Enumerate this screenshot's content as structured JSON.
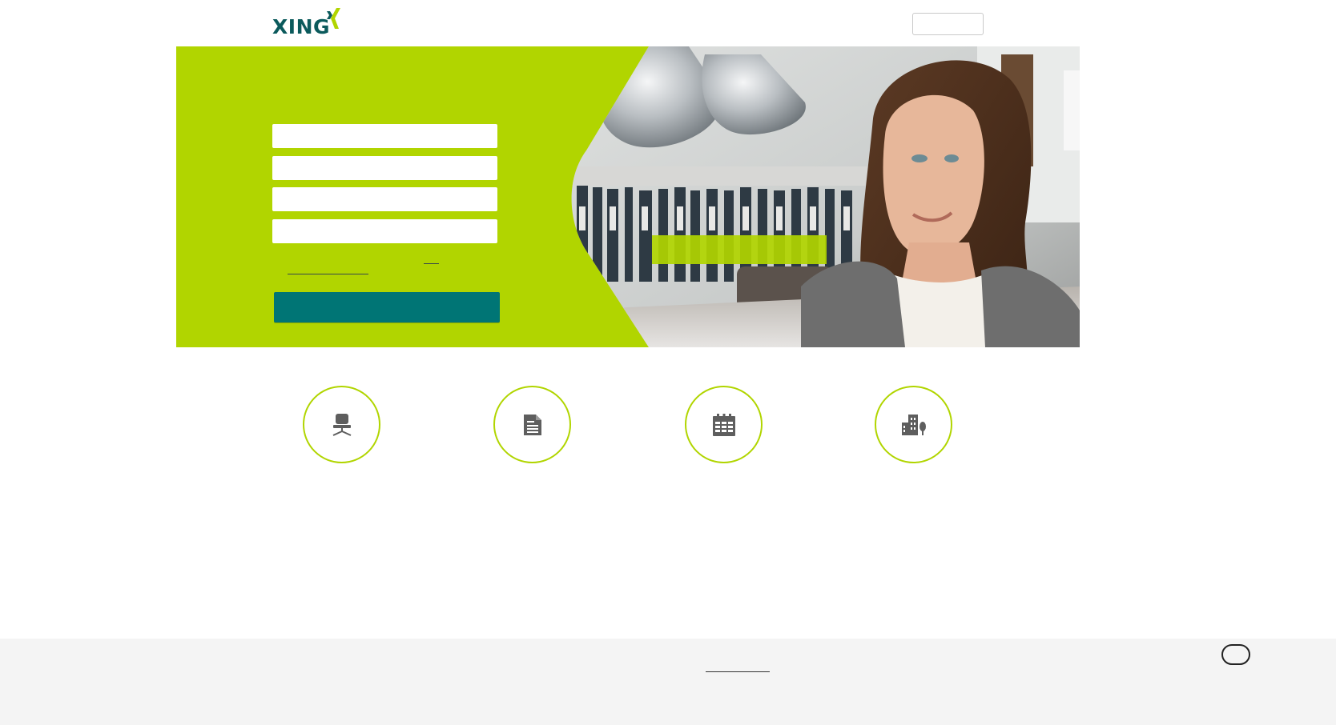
{
  "header": {
    "logo_text": "XING",
    "logo_colors": {
      "text": "#0b5a5c",
      "mark_left": "#0b5a5c",
      "mark_right": "#b1d500"
    }
  },
  "hero": {
    "background_color": "#b1d500",
    "form_fields": [
      "",
      "",
      "",
      ""
    ],
    "register_button_color": "#007575",
    "cta_color": "#b1d500"
  },
  "features": [
    {
      "icon": "office-chair-icon"
    },
    {
      "icon": "document-icon"
    },
    {
      "icon": "calendar-icon"
    },
    {
      "icon": "company-buildings-icon"
    }
  ],
  "colors": {
    "accent_green": "#b1d500",
    "teal": "#007575",
    "icon_gray": "#5e5e5e",
    "footer_bg": "#f4f4f4"
  }
}
